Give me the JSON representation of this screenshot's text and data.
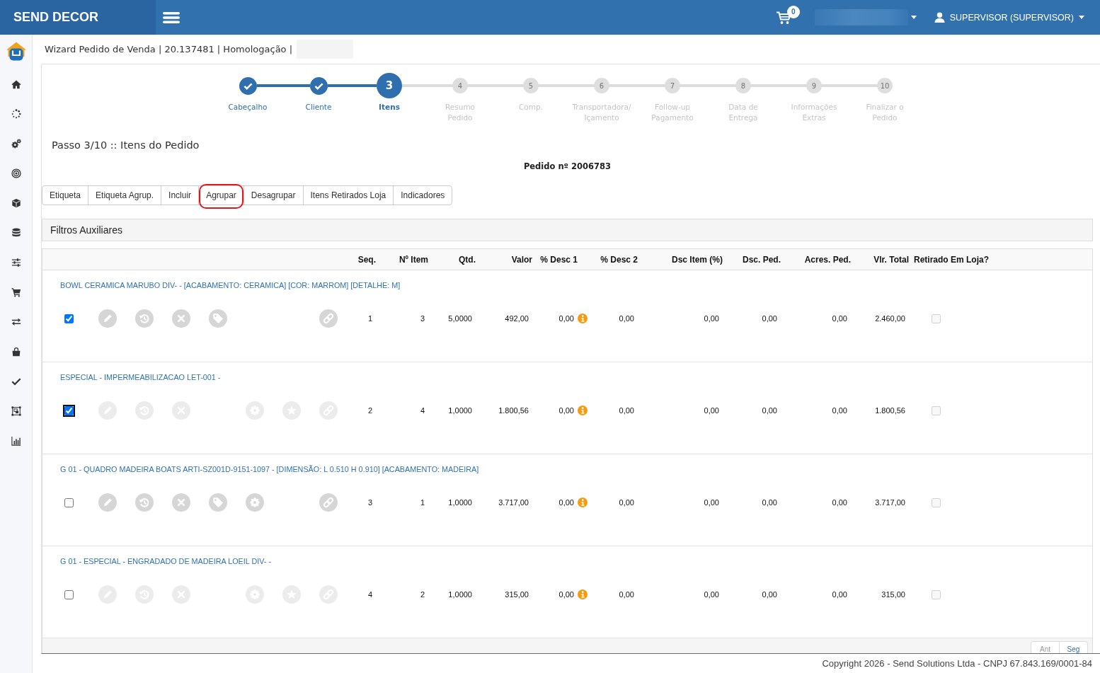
{
  "topbar": {
    "brand": "SEND DECOR",
    "cart_count": "0",
    "user": "SUPERVISOR (SUPERVISOR)"
  },
  "breadcrumb": "Wizard Pedido de Venda | 20.137481 | Homologação |",
  "steps": [
    {
      "label": "Cabeçalho",
      "completed": true,
      "selected": false
    },
    {
      "label": "Cliente",
      "completed": true,
      "selected": false
    },
    {
      "number": "3",
      "label": "Itens",
      "completed": false,
      "selected": true
    },
    {
      "number": "4",
      "label": "Resumo\nPedido",
      "completed": false,
      "selected": false
    },
    {
      "number": "5",
      "label": "Comp.",
      "completed": false,
      "selected": false
    },
    {
      "number": "6",
      "label": "Transportadora/\nIçamento",
      "completed": false,
      "selected": false
    },
    {
      "number": "7",
      "label": "Follow-up\nPagamento",
      "completed": false,
      "selected": false
    },
    {
      "number": "8",
      "label": "Data de\nEntrega",
      "completed": false,
      "selected": false
    },
    {
      "number": "9",
      "label": "Informações\nExtras",
      "completed": false,
      "selected": false
    },
    {
      "number": "10",
      "label": "Finalizar o\nPedido",
      "completed": false,
      "selected": false
    }
  ],
  "step_title": "Passo 3/10 :: Itens do Pedido",
  "order_number": "Pedido nº 2006783",
  "toolbar_buttons": [
    {
      "label": "Etiqueta",
      "highlighted": false
    },
    {
      "label": "Etiqueta Agrup.",
      "highlighted": false
    },
    {
      "label": "Incluir",
      "highlighted": false
    },
    {
      "label": "Agrupar",
      "highlighted": true
    },
    {
      "label": "Desagrupar",
      "highlighted": false
    },
    {
      "label": "Itens Retirados Loja",
      "highlighted": false
    },
    {
      "label": "Indicadores",
      "highlighted": false
    }
  ],
  "filters_panel": {
    "title": "Filtros Auxiliares"
  },
  "table": {
    "columns": [
      {
        "label": "Seq.",
        "kind": "number"
      },
      {
        "label": "Nº Item",
        "kind": "number"
      },
      {
        "label": "Qtd.",
        "kind": "number"
      },
      {
        "label": "Valor",
        "kind": "number"
      },
      {
        "label": "% Desc 1",
        "kind": "number_info"
      },
      {
        "label": "% Desc 2",
        "kind": "number"
      },
      {
        "label": "Dsc Item (%)",
        "kind": "number"
      },
      {
        "label": "Dsc. Ped.",
        "kind": "number"
      },
      {
        "label": "Acres. Ped.",
        "kind": "number"
      },
      {
        "label": "Vlr. Total",
        "kind": "number"
      },
      {
        "label": "Retirado Em Loja?",
        "kind": "checkbox"
      }
    ],
    "rows": [
      {
        "description": "BOWL CERAMICA MARUBO DIV- - [ACABAMENTO: CERAMICA] [COR: MARROM] [DETALHE: M]",
        "selected": true,
        "focused": false,
        "actions": [
          {
            "kind": "edit",
            "disabled": false
          },
          {
            "kind": "history",
            "disabled": false
          },
          {
            "kind": "remove",
            "disabled": false
          },
          {
            "kind": "tag",
            "disabled": false
          },
          {
            "kind": "link",
            "disabled": false
          }
        ],
        "cells": [
          "1",
          "3",
          "5,0000",
          "492,00",
          "0,00",
          "0,00",
          "0,00",
          "0,00",
          "0,00",
          "2.460,00"
        ],
        "store_pickup": {
          "checked": false,
          "disabled": true
        }
      },
      {
        "description": "ESPECIAL - IMPERMEABILIZACAO LET-001 -",
        "selected": true,
        "focused": true,
        "actions": [
          {
            "kind": "edit",
            "disabled": true
          },
          {
            "kind": "history",
            "disabled": true
          },
          {
            "kind": "remove",
            "disabled": true
          },
          {
            "kind": "settings",
            "disabled": true
          },
          {
            "kind": "favorite",
            "disabled": true
          },
          {
            "kind": "link",
            "disabled": true
          }
        ],
        "cells": [
          "2",
          "4",
          "1,0000",
          "1.800,56",
          "0,00",
          "0,00",
          "0,00",
          "0,00",
          "0,00",
          "1.800,56"
        ],
        "store_pickup": {
          "checked": false,
          "disabled": true
        }
      },
      {
        "description": "G 01 - QUADRO MADEIRA BOATS ARTI-SZ001D-9151-1097 - [DIMENSÃO: L 0.510 H 0.910] [ACABAMENTO: MADEIRA]",
        "selected": false,
        "focused": false,
        "actions": [
          {
            "kind": "edit",
            "disabled": false
          },
          {
            "kind": "history",
            "disabled": false
          },
          {
            "kind": "remove",
            "disabled": false
          },
          {
            "kind": "tag",
            "disabled": false
          },
          {
            "kind": "settings",
            "disabled": false
          },
          {
            "kind": "link",
            "disabled": false
          }
        ],
        "cells": [
          "3",
          "1",
          "1,0000",
          "3.717,00",
          "0,00",
          "0,00",
          "0,00",
          "0,00",
          "0,00",
          "3.717,00"
        ],
        "store_pickup": {
          "checked": false,
          "disabled": true
        }
      },
      {
        "description": "G 01 - ESPECIAL - ENGRADADO DE MADEIRA LOEIL DIV- -",
        "selected": false,
        "focused": false,
        "actions": [
          {
            "kind": "edit",
            "disabled": true
          },
          {
            "kind": "history",
            "disabled": true
          },
          {
            "kind": "remove",
            "disabled": true
          },
          {
            "kind": "settings",
            "disabled": true
          },
          {
            "kind": "favorite",
            "disabled": true
          },
          {
            "kind": "link",
            "disabled": true
          }
        ],
        "cells": [
          "4",
          "2",
          "1,0000",
          "315,00",
          "0,00",
          "0,00",
          "0,00",
          "0,00",
          "0,00",
          "315,00"
        ],
        "store_pickup": {
          "checked": false,
          "disabled": true
        }
      }
    ]
  },
  "pagination": [
    {
      "label": "Ant",
      "disabled": true
    },
    {
      "label": "Seg",
      "disabled": false
    }
  ],
  "footer": "Copyright 2026 - Send Solutions Ltda - CNPJ 67.843.169/0001-84"
}
